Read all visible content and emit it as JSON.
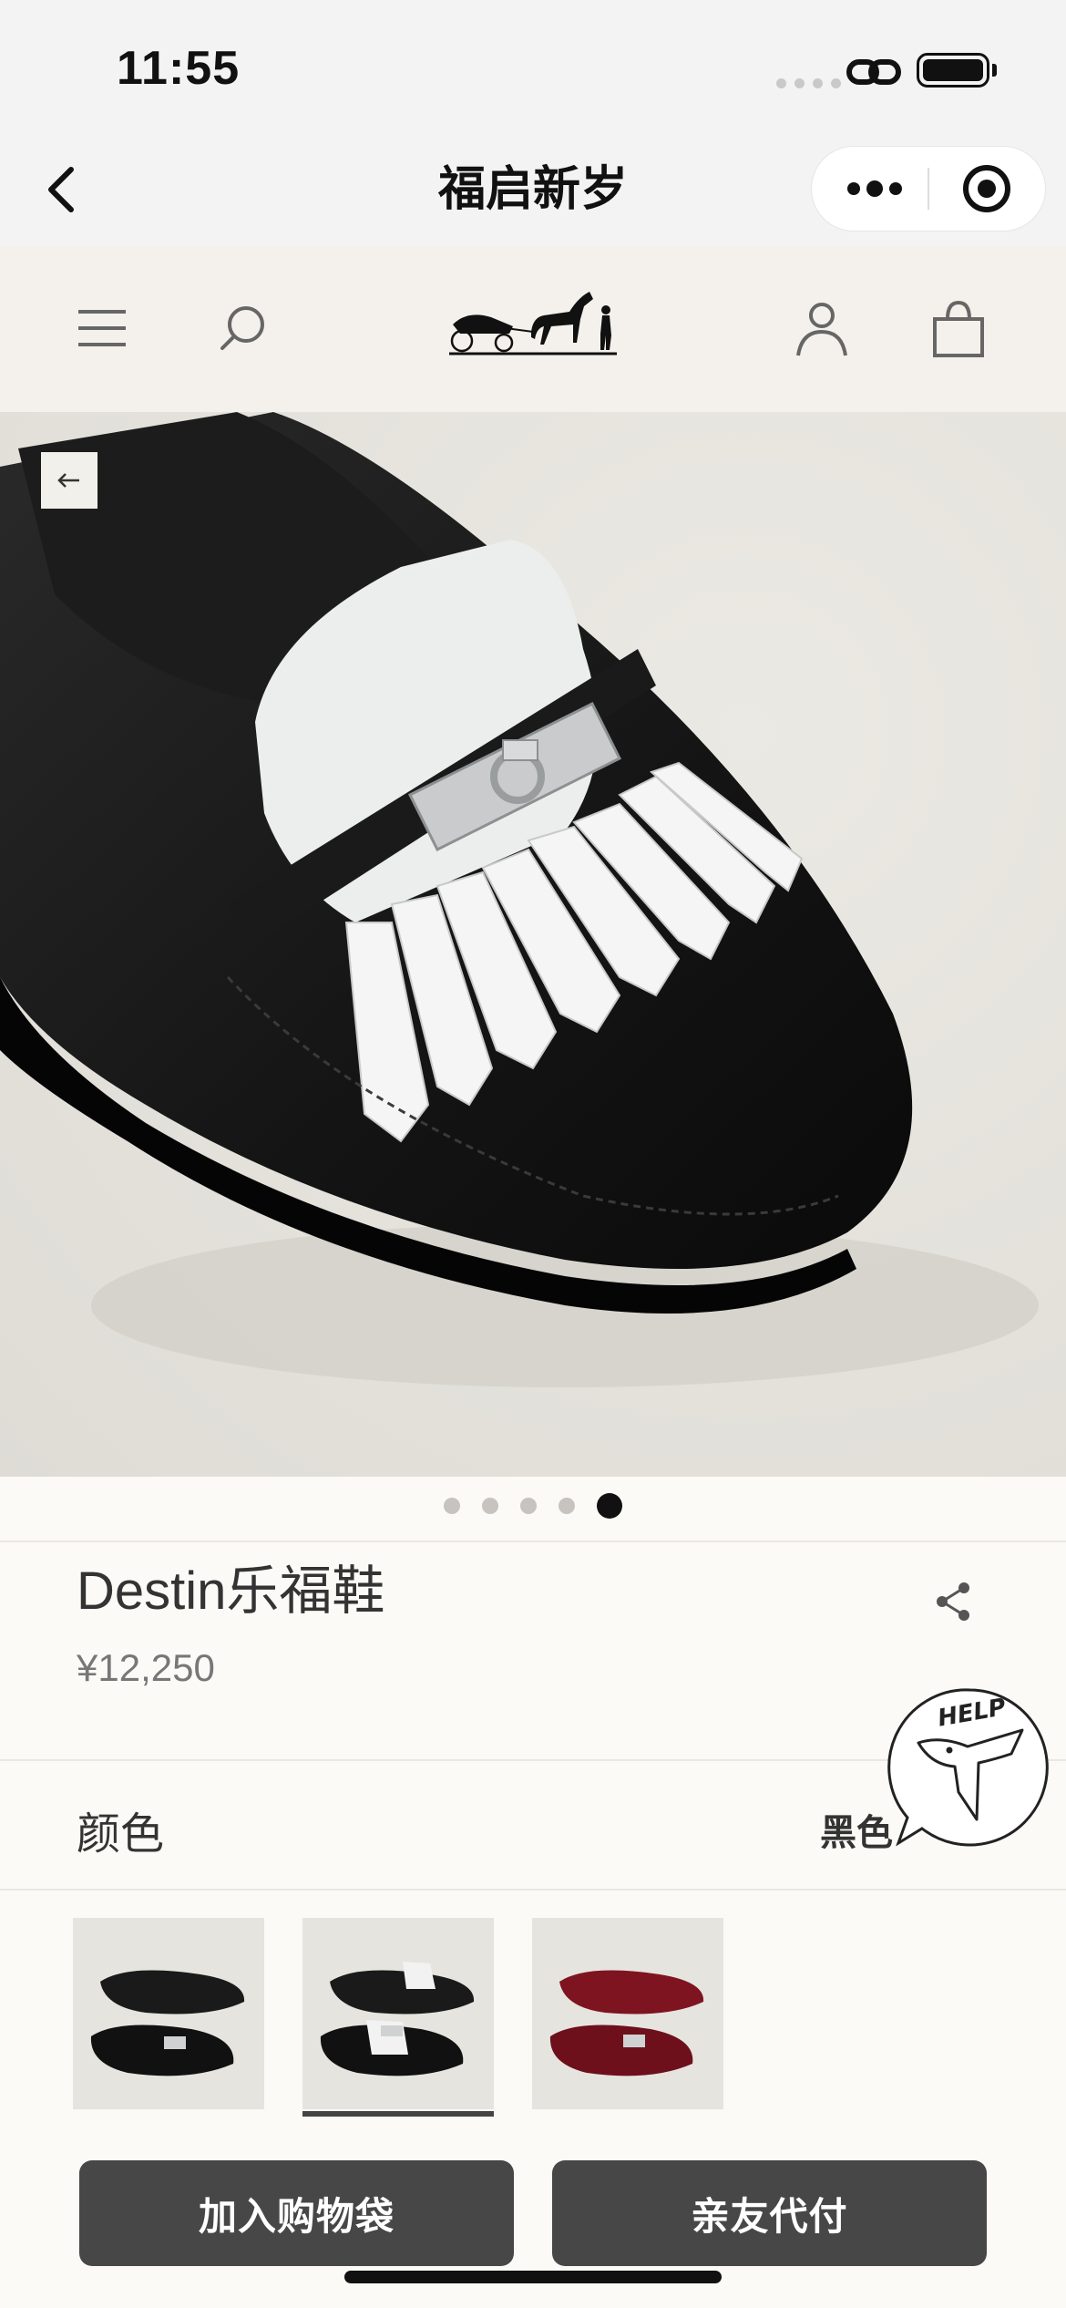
{
  "status_bar": {
    "time": "11:55"
  },
  "nav": {
    "title": "福启新岁",
    "icons": [
      "back-icon",
      "more-icon",
      "target-icon"
    ]
  },
  "header": {
    "icons": [
      "menu-icon",
      "search-icon",
      "hermes-carriage-logo",
      "account-icon",
      "shopping-bag-icon"
    ]
  },
  "gallery": {
    "image": "black-loafer-white-fringe",
    "dots_total": 5,
    "active_dot": 5
  },
  "product": {
    "title": "Destin乐福鞋",
    "price": "¥12,250"
  },
  "color": {
    "label": "颜色",
    "selected": "黑色"
  },
  "swatches": [
    {
      "name": "black-loafer",
      "selected": false
    },
    {
      "name": "black-white-fringe-loafer",
      "selected": true
    },
    {
      "name": "red-loafer",
      "selected": false
    }
  ],
  "help": {
    "label": "HELP"
  },
  "actions": {
    "add_to_bag": "加入购物袋",
    "friend_pay": "亲友代付"
  },
  "colors": {
    "button_bg": "#474747",
    "page_bg": "#fcfaf6",
    "header_bg": "#f4f1ec"
  }
}
